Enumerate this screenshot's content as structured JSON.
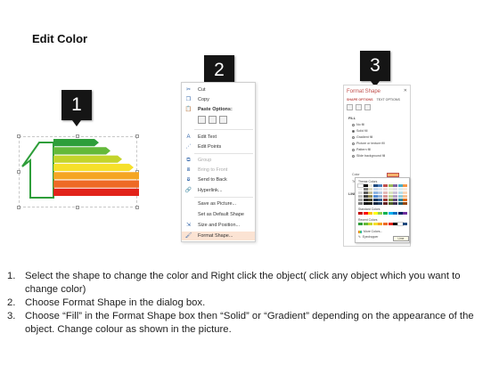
{
  "title": "Edit Color",
  "steps": [
    {
      "number": "1"
    },
    {
      "number": "2"
    },
    {
      "number": "3"
    }
  ],
  "energy_chart": {
    "bar_colors": [
      "#2e9e3a",
      "#64b93a",
      "#c4d42b",
      "#f6e02a",
      "#f5a523",
      "#ee6a26",
      "#e2231a"
    ],
    "outline_color": "#2e9e3a"
  },
  "context_menu": {
    "items": [
      {
        "icon": "cut-icon",
        "glyph": "✂",
        "label": "Cut",
        "enabled": true
      },
      {
        "icon": "copy-icon",
        "glyph": "❐",
        "label": "Copy",
        "enabled": true
      },
      {
        "icon": "paste-icon",
        "glyph": "📋",
        "label": "Paste Options:",
        "enabled": true
      },
      {
        "icon": "edit-text-icon",
        "glyph": "A",
        "label": "Edit Text",
        "enabled": true
      },
      {
        "icon": "edit-points-icon",
        "glyph": "⋰",
        "label": "Edit Points",
        "enabled": true
      },
      {
        "icon": "group-icon",
        "glyph": "⧉",
        "label": "Group",
        "enabled": false
      },
      {
        "icon": "bring-to-front-icon",
        "glyph": "⧈",
        "label": "Bring to Front",
        "enabled": false
      },
      {
        "icon": "send-to-back-icon",
        "glyph": "⧇",
        "label": "Send to Back",
        "enabled": true
      },
      {
        "icon": "hyperlink-icon",
        "glyph": "🔗",
        "label": "Hyperlink...",
        "enabled": true
      },
      {
        "icon": "save-as-picture-icon",
        "glyph": "",
        "label": "Save as Picture...",
        "enabled": true
      },
      {
        "icon": "set-default-shape-icon",
        "glyph": "",
        "label": "Set as Default Shape",
        "enabled": true
      },
      {
        "icon": "size-position-icon",
        "glyph": "⇲",
        "label": "Size and Position...",
        "enabled": true
      },
      {
        "icon": "format-shape-icon",
        "glyph": "🖌",
        "label": "Format Shape...",
        "enabled": true,
        "highlighted": true
      }
    ]
  },
  "format_pane": {
    "title": "Format Shape",
    "tabs": [
      "SHAPE OPTIONS",
      "TEXT OPTIONS"
    ],
    "fill_heading": "FILL",
    "fill_options": [
      {
        "label": "No fill",
        "selected": false
      },
      {
        "label": "Solid fill",
        "selected": true
      },
      {
        "label": "Gradient fill",
        "selected": false
      },
      {
        "label": "Picture or texture fill",
        "selected": false
      },
      {
        "label": "Pattern fill",
        "selected": false
      },
      {
        "label": "Slide background fill",
        "selected": false
      }
    ],
    "color_label": "Color",
    "transparency_label": "Transparency",
    "line_heading": "LINE",
    "accent_color": "#c0504d"
  },
  "color_palette": {
    "theme_label": "Theme Colors",
    "standard_label": "Standard Colors",
    "recent_label": "Recent Colors",
    "more_label": "More Colors...",
    "eyedropper_label": "Eyedropper",
    "tooltip": "Lime",
    "theme_colors": [
      "#ffffff",
      "#000000",
      "#eeece1",
      "#1f497d",
      "#4f81bd",
      "#c0504d",
      "#9bbb59",
      "#8064a2",
      "#4bacc6",
      "#f79646",
      "#f2f2f2",
      "#7f7f7f",
      "#ddd9c3",
      "#c6d9f0",
      "#dbe5f1",
      "#f2dcdb",
      "#ebf1dd",
      "#e5e0ec",
      "#dbeef3",
      "#fdeada",
      "#d8d8d8",
      "#595959",
      "#c4bd97",
      "#8db3e2",
      "#b8cce4",
      "#e5b9b7",
      "#d7e3bc",
      "#ccc1d9",
      "#b7dde8",
      "#fbd5b5",
      "#bfbfbf",
      "#3f3f3f",
      "#938953",
      "#548dd4",
      "#95b3d7",
      "#d99694",
      "#c3d69b",
      "#b2a2c7",
      "#92cddc",
      "#fac08f",
      "#a5a5a5",
      "#262626",
      "#494429",
      "#17365d",
      "#366092",
      "#953734",
      "#76923c",
      "#5f497a",
      "#31859b",
      "#e36c09",
      "#7f7f7f",
      "#0c0c0c",
      "#1d1b10",
      "#0f243e",
      "#244061",
      "#632423",
      "#4f6128",
      "#3f3151",
      "#205867",
      "#974806"
    ],
    "standard_colors": [
      "#c00000",
      "#ff0000",
      "#ffc000",
      "#ffff00",
      "#92d050",
      "#00b050",
      "#00b0f0",
      "#0070c0",
      "#002060",
      "#7030a0"
    ],
    "recent_colors": [
      "#2e9e3a",
      "#64b93a",
      "#c4d42b",
      "#f6e02a",
      "#f5a523",
      "#ee6a26",
      "#e2231a",
      "#000000",
      "#ffffff",
      "#1f497d"
    ]
  },
  "instructions": [
    {
      "n": "1.",
      "text": "Select the shape to change the color and Right click the object( click any object which you want to change color)"
    },
    {
      "n": "2.",
      "text": "Choose Format Shape in the dialog box."
    },
    {
      "n": "3.",
      "text": "Choose “Fill” in the Format Shape box then “Solid” or “Gradient” depending on the appearance of the object. Change colour as shown in the picture."
    }
  ]
}
